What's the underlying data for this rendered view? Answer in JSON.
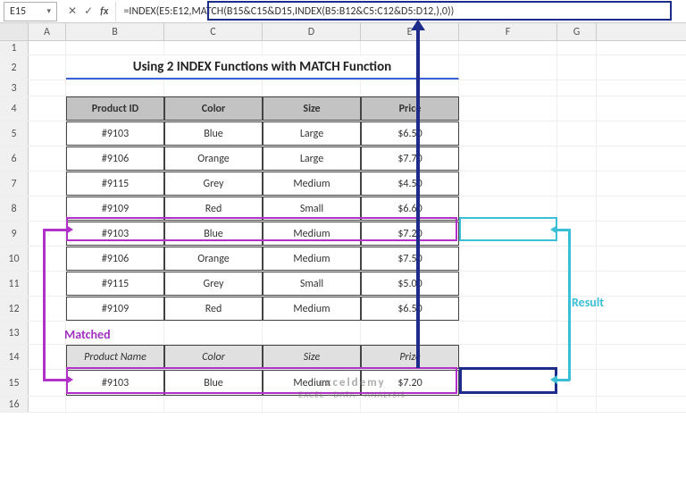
{
  "namebox": "E15",
  "formula": "=INDEX(E5:E12,MATCH(B15&C15&D15,INDEX(B5:B12&C5:C12&D5:D12,),0))",
  "columns": [
    "A",
    "B",
    "C",
    "D",
    "E",
    "F",
    "G"
  ],
  "row_nums": [
    "1",
    "2",
    "3",
    "4",
    "5",
    "6",
    "7",
    "8",
    "9",
    "10",
    "11",
    "12",
    "13",
    "14",
    "15",
    "16"
  ],
  "title": "Using 2 INDEX Functions with MATCH Function",
  "headers": {
    "b": "Product ID",
    "c": "Color",
    "d": "Size",
    "e": "Price"
  },
  "rows": [
    {
      "b": "#9103",
      "c": "Blue",
      "d": "Large",
      "e": "$6.50"
    },
    {
      "b": "#9106",
      "c": "Orange",
      "d": "Large",
      "e": "$7.70"
    },
    {
      "b": "#9115",
      "c": "Grey",
      "d": "Medium",
      "e": "$4.50"
    },
    {
      "b": "#9109",
      "c": "Red",
      "d": "Small",
      "e": "$6.60"
    },
    {
      "b": "#9103",
      "c": "Blue",
      "d": "Medium",
      "e": "$7.20"
    },
    {
      "b": "#9106",
      "c": "Orange",
      "d": "Medium",
      "e": "$7.50"
    },
    {
      "b": "#9115",
      "c": "Grey",
      "d": "Small",
      "e": "$5.00"
    },
    {
      "b": "#9109",
      "c": "Red",
      "d": "Medium",
      "e": "$6.50"
    }
  ],
  "lookup_headers": {
    "b": "Product Name",
    "c": "Color",
    "d": "Size",
    "e": "Prize"
  },
  "lookup": {
    "b": "#9103",
    "c": "Blue",
    "d": "Medium",
    "e": "$7.20"
  },
  "ann": {
    "matched": "Matched",
    "result": "Result"
  },
  "watermark": {
    "line1": "exceldemy",
    "line2": "EXCEL · DATA · ANALYSIS"
  },
  "icons": {
    "dd": "▾",
    "cancel": "✕",
    "confirm": "✓",
    "fx": "fx"
  }
}
